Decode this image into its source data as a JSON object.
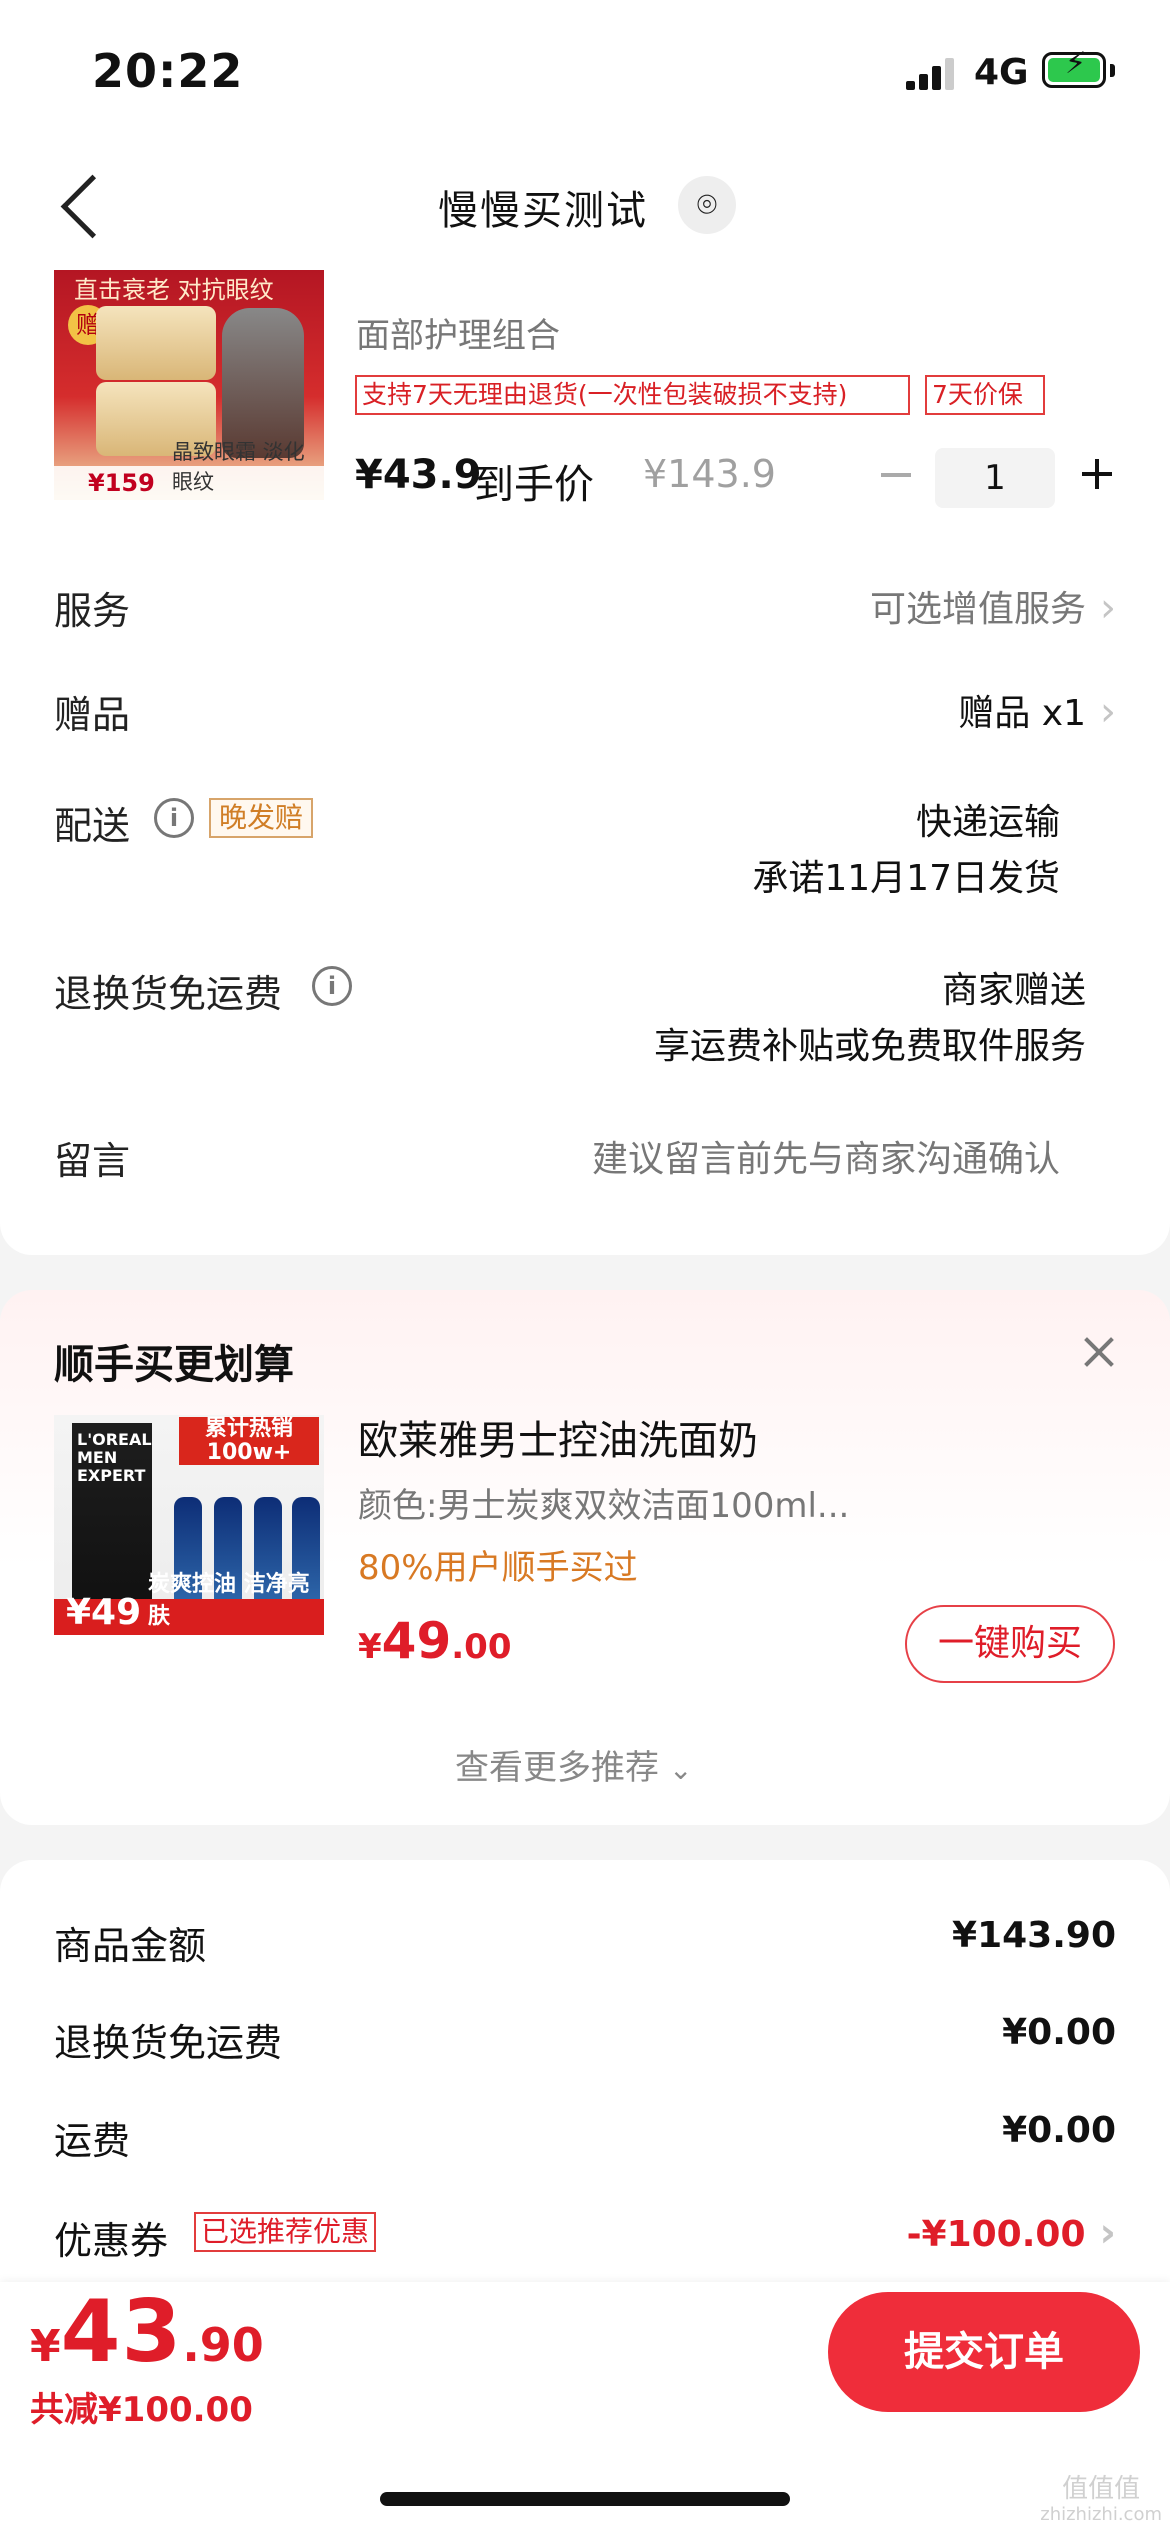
{
  "status_bar": {
    "time": "20:22",
    "network": "4G",
    "battery_level": 1.0,
    "battery_color": "#2dc84d"
  },
  "nav": {
    "title": "慢慢买测试",
    "back_icon": "chevron-left-icon",
    "pin_icon": "location-pin-icon",
    "pin_glyph": "⌾"
  },
  "order_item": {
    "image_text": {
      "top": "直击衰老 对抗眼纹",
      "gift": "赠",
      "price": "¥159",
      "bottom": "晶致眼霜 淡化眼纹"
    },
    "subtitle": "面部护理组合",
    "return_tag": "支持7天无理由退货(一次性包装破损不支持)",
    "price_protect_tag": "7天价保",
    "price": "¥43.9",
    "price_label": "到手价",
    "original_price": "¥143.9",
    "quantity": "1"
  },
  "order_options": {
    "service": {
      "label": "服务",
      "value": "可选增值服务"
    },
    "gift": {
      "label": "赠品",
      "value": "赠品 x1"
    },
    "delivery": {
      "label": "配送",
      "badge": "晚发赔",
      "method": "快递运输",
      "promise": "承诺11月17日发货"
    },
    "return_shipping": {
      "label": "退换货免运费",
      "line1": "商家赠送",
      "line2": "享运费补贴或免费取件服务"
    },
    "message": {
      "label": "留言",
      "placeholder": "建议留言前先与商家沟通确认"
    }
  },
  "upsell": {
    "title": "顺手买更划算",
    "product_name": "欧莱雅男士控油洗面奶",
    "variant": "颜色:男士炭爽双效洁面100ml...",
    "rate": "80%用户顺手买过",
    "currency": "¥",
    "price_int": "49",
    "price_dec": ".00",
    "buy_label": "一键购买",
    "more_label": "查看更多推荐",
    "more_icon": "chevron-down-icon",
    "image_text": {
      "brand": "L'OREAL MEN EXPERT",
      "hot": "累计热销100w+",
      "price": "¥49",
      "bottom": "炭爽控油 洁净亮肤"
    }
  },
  "totals": {
    "goods_amount": {
      "label": "商品金额",
      "value": "¥143.90"
    },
    "return_shipping": {
      "label": "退换货免运费",
      "value": "¥0.00"
    },
    "shipping": {
      "label": "运费",
      "value": "¥0.00"
    },
    "coupon": {
      "label": "优惠券",
      "tag": "已选推荐优惠",
      "value": "-¥100.00"
    }
  },
  "bottom_bar": {
    "currency": "¥",
    "price_int": "43",
    "price_dec": ".90",
    "saved": "共减¥100.00",
    "submit": "提交订单"
  },
  "watermark": {
    "line1": "值值值",
    "line2": "zhizhizhi.com"
  },
  "colors": {
    "accent_red": "#df1d29",
    "submit_red": "#ef2d3a",
    "orange": "#d87923"
  }
}
